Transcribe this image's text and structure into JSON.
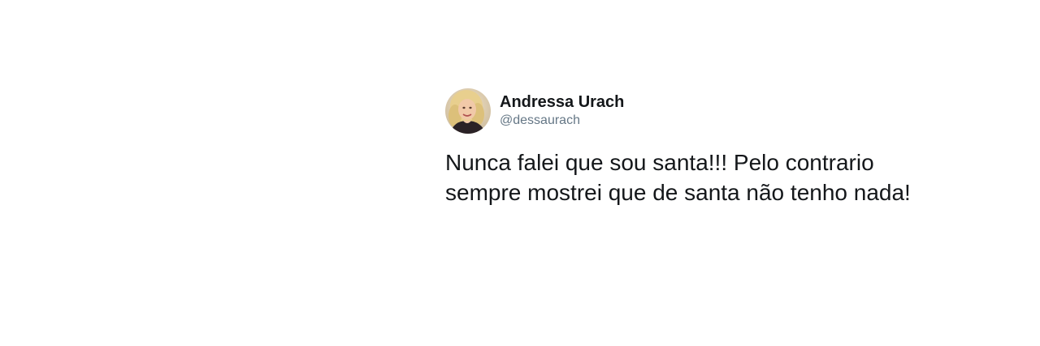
{
  "tweet": {
    "display_name": "Andressa Urach",
    "handle": "@dessaurach",
    "avatar_icon": "profile-photo",
    "text": "Nunca falei que sou santa!!! Pelo contrario sempre mostrei que de santa não tenho nada!"
  },
  "colors": {
    "name": "#14171a",
    "handle": "#657786",
    "background": "#ffffff"
  }
}
